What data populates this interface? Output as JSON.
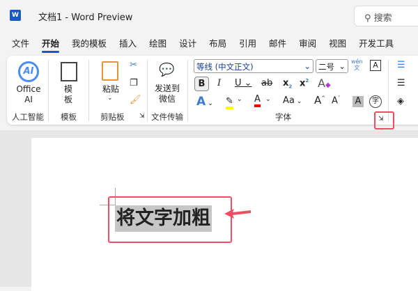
{
  "titlebar": {
    "logo": "W",
    "title": "文档1  -  Word Preview",
    "search": "搜索"
  },
  "tabs": [
    "文件",
    "开始",
    "我的模板",
    "插入",
    "绘图",
    "设计",
    "布局",
    "引用",
    "邮件",
    "审阅",
    "视图",
    "开发工具"
  ],
  "ribbon": {
    "office_ai": "Office AI",
    "group_ai": "人工智能",
    "template": "模板",
    "group_template": "模板",
    "paste": "粘贴",
    "group_clipboard": "剪贴板",
    "send_wechat": "发送到微信",
    "group_transfer": "文件传输",
    "font_name": "等线 (中文正文)",
    "font_size": "二号",
    "phonetic": "wén",
    "phonetic_char": "文",
    "group_font": "字体"
  },
  "document": {
    "text": "将文字加粗"
  },
  "colors": {
    "accent": "#185abd",
    "highlight": "#ffff00",
    "font_color": "#ff0000",
    "annotation": "#ef4d63"
  }
}
